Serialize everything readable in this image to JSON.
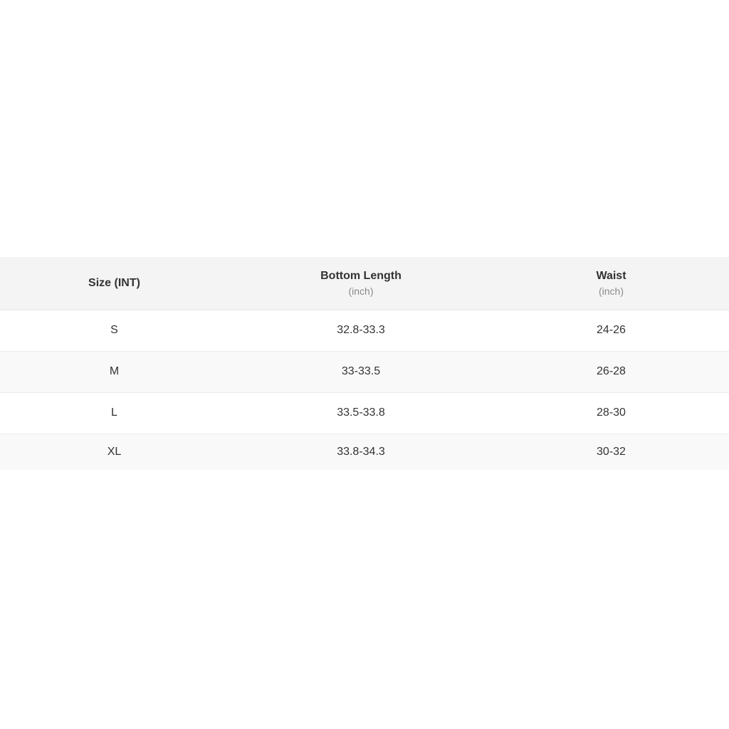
{
  "size_chart": {
    "headers": [
      {
        "label": "Size (INT)",
        "unit": ""
      },
      {
        "label": "Bottom Length",
        "unit": "(inch)"
      },
      {
        "label": "Waist",
        "unit": "(inch)"
      }
    ],
    "rows": [
      {
        "size": "S",
        "bottom_length": "32.8-33.3",
        "waist": "24-26"
      },
      {
        "size": "M",
        "bottom_length": "33-33.5",
        "waist": "26-28"
      },
      {
        "size": "L",
        "bottom_length": "33.5-33.8",
        "waist": "28-30"
      },
      {
        "size": "XL",
        "bottom_length": "33.8-34.3",
        "waist": "30-32"
      }
    ]
  }
}
